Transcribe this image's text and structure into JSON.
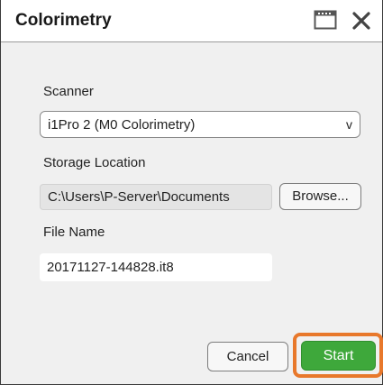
{
  "window": {
    "title": "Colorimetry",
    "icons": [
      "window-icon",
      "close-icon"
    ]
  },
  "scanner": {
    "label": "Scanner",
    "selected": "i1Pro 2 (M0 Colorimetry)",
    "chevron": "v"
  },
  "storage": {
    "label": "Storage Location",
    "path": "C:\\Users\\P-Server\\Documents",
    "browse_label": "Browse..."
  },
  "file": {
    "label": "File Name",
    "value": "20171127-144828.it8"
  },
  "buttons": {
    "cancel_label": "Cancel",
    "start_label": "Start"
  },
  "colors": {
    "accent_green": "#3ea83b",
    "highlight_orange": "#e8782b"
  }
}
